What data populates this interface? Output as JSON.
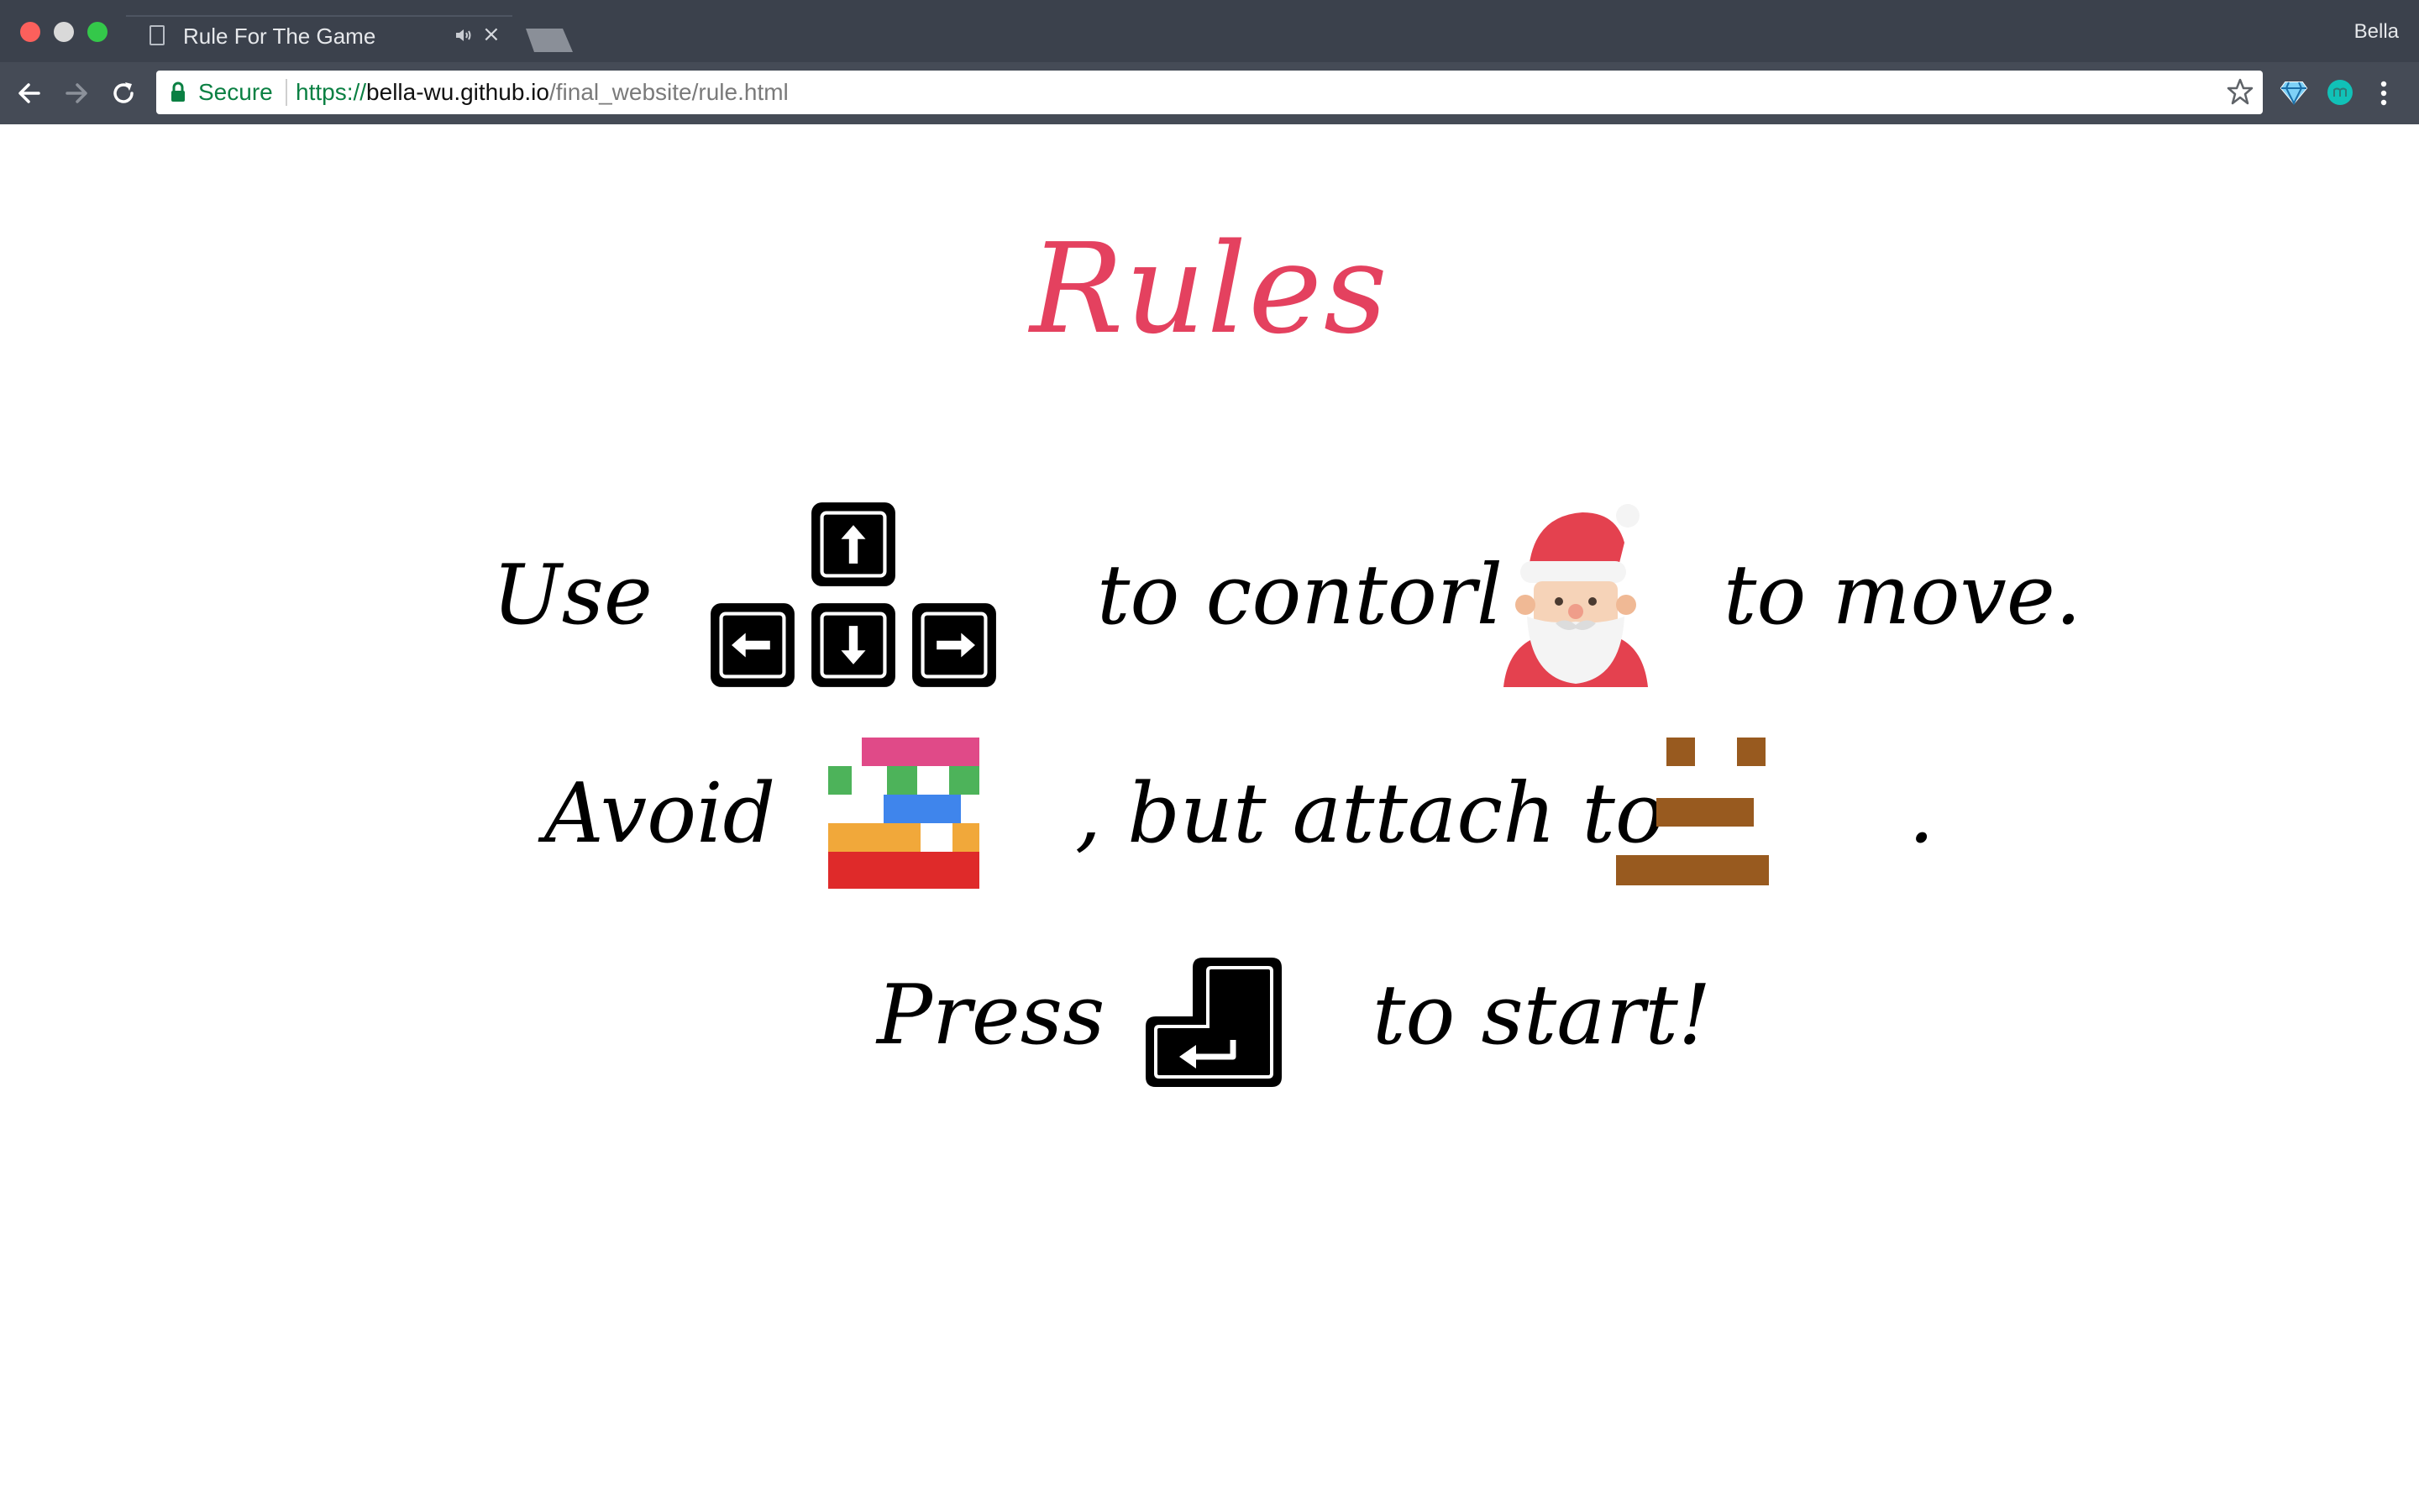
{
  "browser": {
    "tab_title": "Rule For The Game",
    "close_glyph": "×",
    "user_name": "Bella",
    "address": {
      "secure_label": "Secure",
      "scheme": "https://",
      "host": "bella-wu.github.io",
      "path": "/final_website/rule.html"
    }
  },
  "page": {
    "heading": "Rules",
    "row1": {
      "use": "Use",
      "to_control": "to contorl",
      "to_move": "to move."
    },
    "row2": {
      "avoid": "Avoid",
      "but_attach": ", but attach to",
      "period": "."
    },
    "row3": {
      "press": "Press",
      "to_start": "to start!"
    }
  },
  "colors": {
    "heading": "#e4415f",
    "chrome_dark": "#3b414c",
    "secure_green": "#0b8043",
    "platform_brown": "#985a1f"
  },
  "icons": [
    "document-icon",
    "audio-icon",
    "close-icon",
    "back-icon",
    "forward-icon",
    "reload-icon",
    "lock-icon",
    "star-icon",
    "extension-gem-icon",
    "extension-m-icon",
    "menu-icon",
    "arrow-up-key-icon",
    "arrow-left-key-icon",
    "arrow-down-key-icon",
    "arrow-right-key-icon",
    "santa-icon",
    "obstacle-blocks-icon",
    "platform-icon",
    "enter-key-icon"
  ]
}
